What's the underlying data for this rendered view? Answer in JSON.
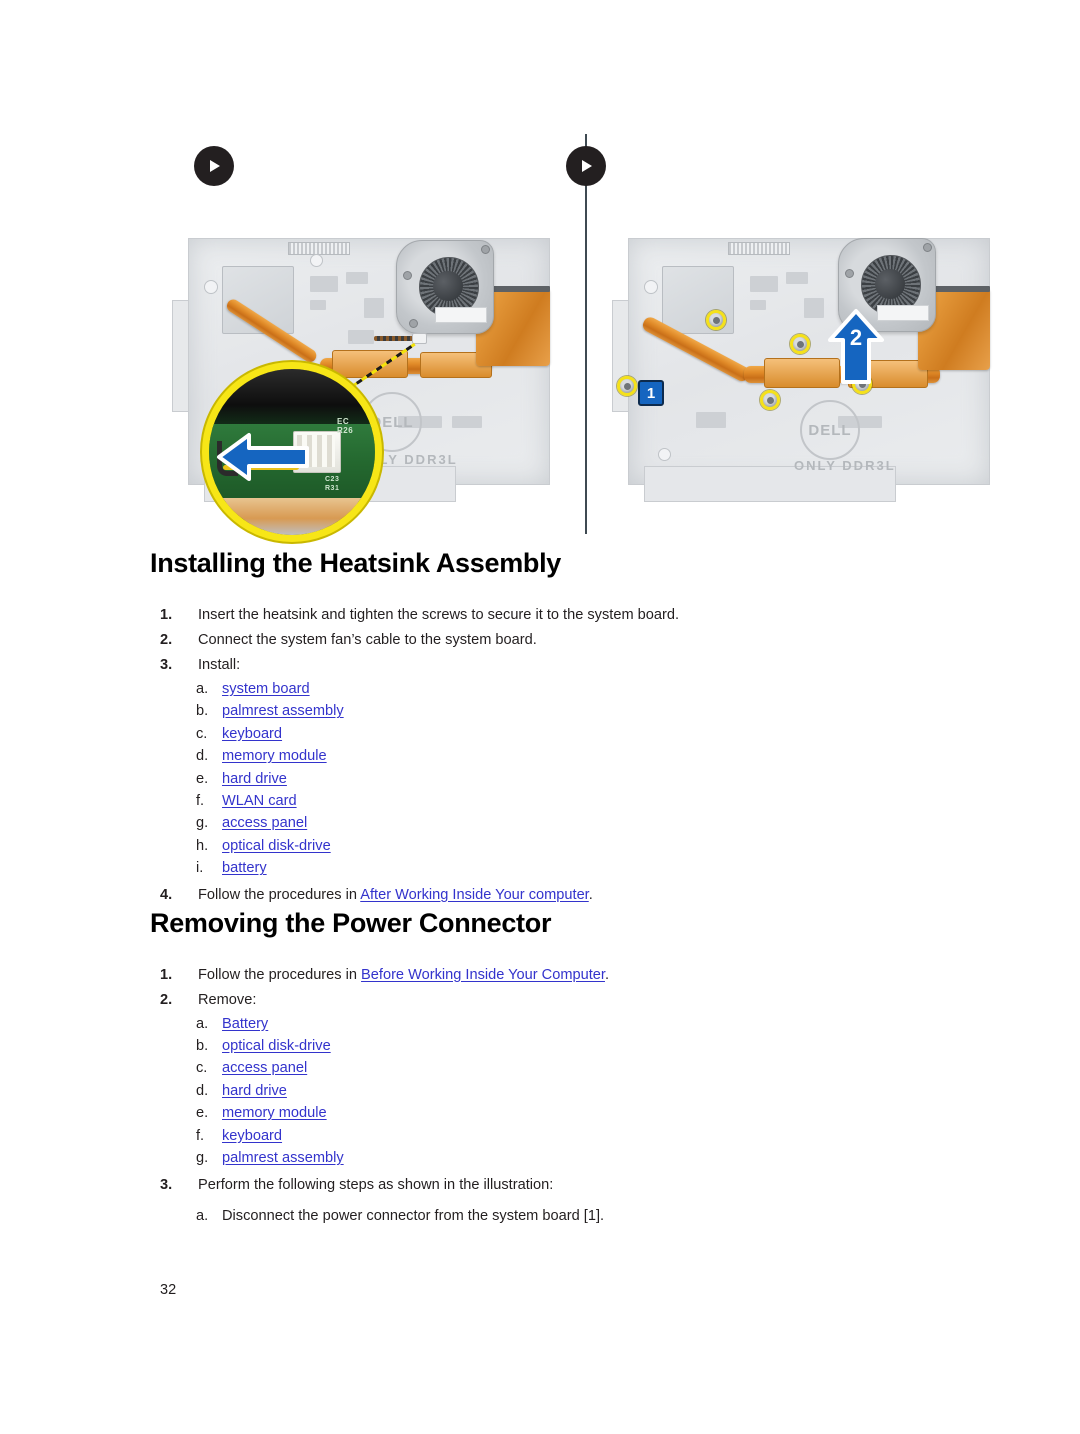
{
  "page": {
    "number": "32"
  },
  "figure": {
    "play_icon_left": "play-icon",
    "play_icon_right": "play-icon",
    "divider": "figure-divider",
    "left_panel": {
      "name": "heatsink-fan-cable-illustration",
      "board_text_brand": "DELL",
      "board_text_memory": "ONLY  DDR3L",
      "magnifier_silk_top": "EC\nR26",
      "magnifier_silk_bottom": "C23\nR31",
      "arrow_direction": "left"
    },
    "right_panel": {
      "name": "heatsink-removal-illustration",
      "board_text_brand": "DELL",
      "board_text_memory": "ONLY  DDR3L",
      "callouts": [
        {
          "label": "1",
          "style": "square-badge"
        },
        {
          "label": "2",
          "style": "up-arrow"
        }
      ]
    }
  },
  "sections": [
    {
      "heading": "Installing the Heatsink Assembly",
      "steps": [
        {
          "marker": "1.",
          "text": "Insert the heatsink and tighten the screws to secure it to the system board."
        },
        {
          "marker": "2.",
          "text": "Connect the system fan’s cable to the system board."
        },
        {
          "marker": "3.",
          "text": "Install:"
        }
      ],
      "sub_items": [
        {
          "marker": "a.",
          "text": "system board",
          "link": true
        },
        {
          "marker": "b.",
          "text": "palmrest assembly",
          "link": true
        },
        {
          "marker": "c.",
          "text": "keyboard",
          "link": true
        },
        {
          "marker": "d.",
          "text": "memory module",
          "link": true
        },
        {
          "marker": "e.",
          "text": "hard drive",
          "link": true
        },
        {
          "marker": "f.",
          "text": "WLAN card",
          "link": true
        },
        {
          "marker": "g.",
          "text": "access panel",
          "link": true
        },
        {
          "marker": "h.",
          "text": "optical disk-drive",
          "link": true
        },
        {
          "marker": "i.",
          "text": "battery",
          "link": true
        }
      ],
      "final_step": {
        "marker": "4.",
        "prefix": "Follow the procedures in ",
        "link": "After Working Inside Your computer",
        "suffix": "."
      }
    },
    {
      "heading": "Removing the Power Connector",
      "steps": [
        {
          "marker": "1.",
          "prefix": "Follow the procedures in ",
          "link": "Before Working Inside Your Computer",
          "suffix": "."
        },
        {
          "marker": "2.",
          "text": "Remove:"
        }
      ],
      "sub_items": [
        {
          "marker": "a.",
          "text": "Battery",
          "link": true
        },
        {
          "marker": "b.",
          "text": "optical disk-drive",
          "link": true
        },
        {
          "marker": "c.",
          "text": "access panel",
          "link": true
        },
        {
          "marker": "d.",
          "text": "hard drive",
          "link": true
        },
        {
          "marker": "e.",
          "text": "memory module",
          "link": true
        },
        {
          "marker": "f.",
          "text": "keyboard",
          "link": true
        },
        {
          "marker": "g.",
          "text": "palmrest assembly",
          "link": true
        }
      ],
      "final_step": {
        "marker": "3.",
        "text": "Perform the following steps as shown in the illustration:"
      },
      "final_sub": {
        "marker": "a.",
        "text": "Disconnect the power connector from the system board [1]."
      }
    }
  ],
  "colors": {
    "link": "#3333CC",
    "text": "#231F20",
    "callout_badge": "#1565C0",
    "highlight_ring": "#F5E11A",
    "copper": "#D98C2C"
  }
}
